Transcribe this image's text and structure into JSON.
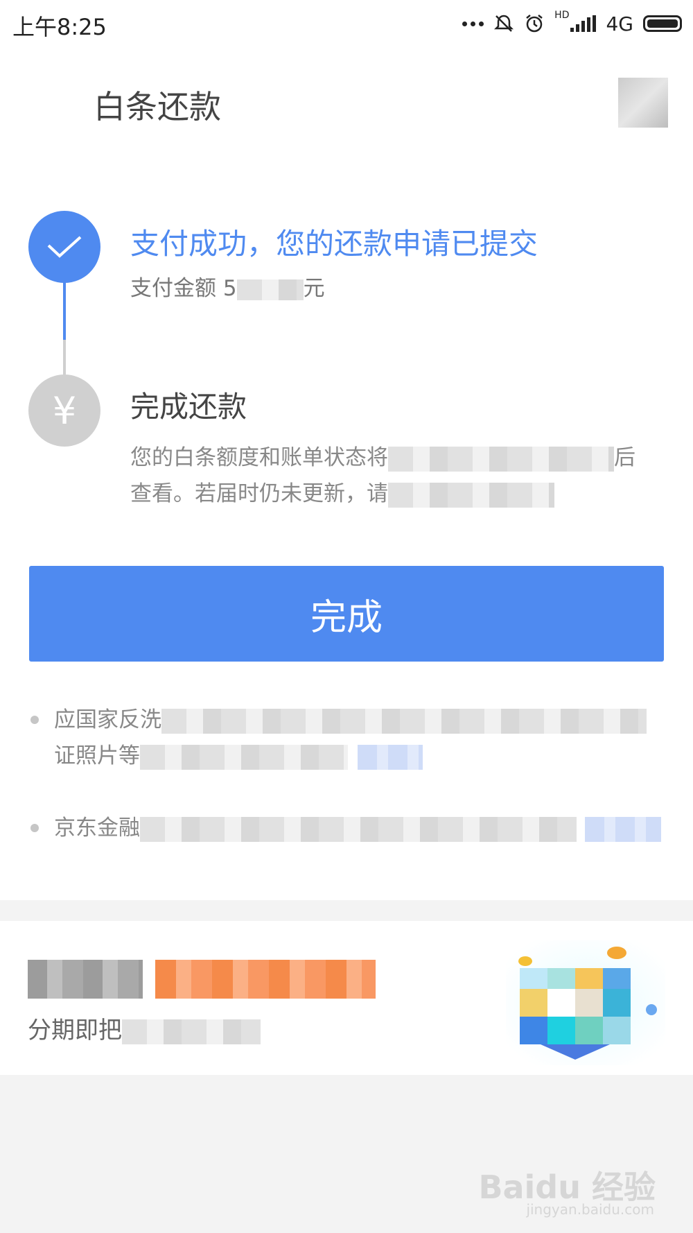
{
  "status_bar": {
    "time": "上午8:25",
    "network": "4G",
    "hd": "HD",
    "icons": [
      "dots-icon",
      "mute-icon",
      "alarm-icon",
      "signal-icon",
      "battery-icon"
    ]
  },
  "header": {
    "title": "白条还款"
  },
  "steps": [
    {
      "title": "支付成功，您的还款申请已提交",
      "amount_label": "支付金额",
      "amount_value": "5",
      "amount_unit": "元",
      "icon": "check-icon",
      "status_color": "#4f8af0"
    },
    {
      "title": "完成还款",
      "desc_part1": "您的白条额度和账单状态将",
      "desc_part2": "后",
      "desc_part3": "查看。若届时仍未更新，请",
      "icon": "yuan-icon",
      "icon_glyph": "¥",
      "status_color": "#d0d0d0"
    }
  ],
  "done_button": {
    "label": "完成",
    "color": "#4f8af0"
  },
  "notices": [
    {
      "line1": "应国家反洗",
      "line2": "证照片等"
    },
    {
      "line1": "京东金融"
    }
  ],
  "promo": {
    "subtitle": "分期即把"
  },
  "watermark": {
    "text": "Baidu 经验",
    "sub": "jingyan.baidu.com"
  }
}
